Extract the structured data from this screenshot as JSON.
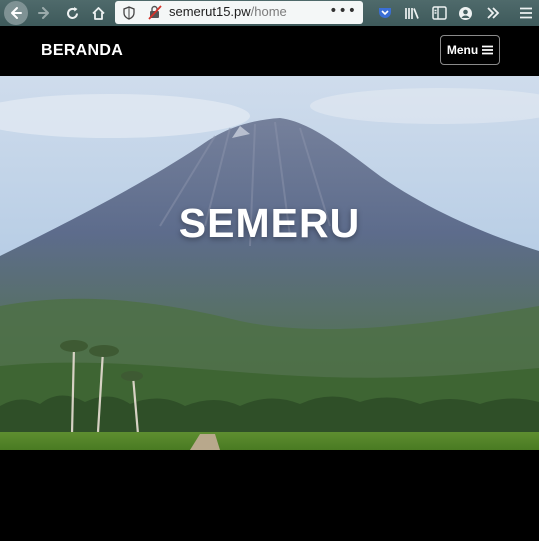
{
  "browser": {
    "url_domain": "semerut15.pw",
    "url_path": "/home",
    "page_actions": "•••"
  },
  "navbar": {
    "brand": "BERANDA",
    "menu_label": "Menu"
  },
  "hero": {
    "title": "SEMERU"
  },
  "colors": {
    "toolbar": "#466162",
    "navbar": "#000000",
    "sky": "#b9cfe6",
    "mountain": "#5f6f8e",
    "field": "#5a8a2e"
  }
}
